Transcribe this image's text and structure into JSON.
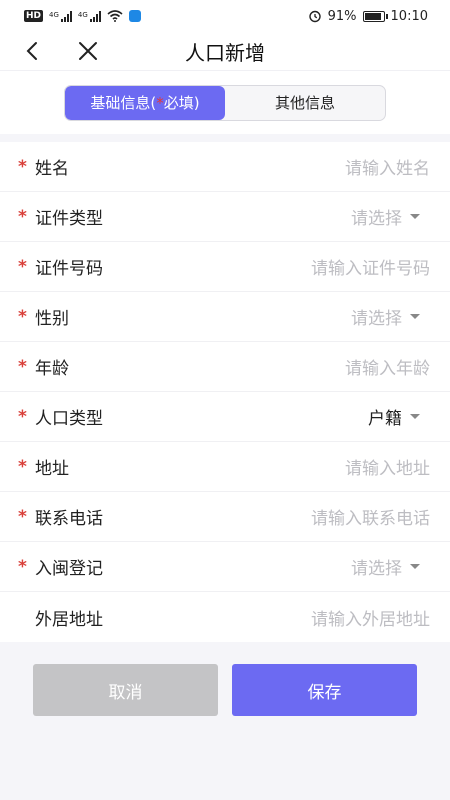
{
  "status_bar": {
    "hd": "HD",
    "sig1": "4G",
    "sig2": "4G",
    "battery_percent": "91%",
    "battery_level": 0.91,
    "time": "10:10"
  },
  "nav": {
    "title": "人口新增"
  },
  "tabs": {
    "basic_prefix": "基础信息(",
    "basic_star": "*",
    "basic_suffix": "必填)",
    "other": "其他信息"
  },
  "form": {
    "rows": [
      {
        "label": "姓名",
        "required": true,
        "value": "请输入姓名",
        "type": "input"
      },
      {
        "label": "证件类型",
        "required": true,
        "value": "请选择",
        "type": "select"
      },
      {
        "label": "证件号码",
        "required": true,
        "value": "请输入证件号码",
        "type": "input"
      },
      {
        "label": "性别",
        "required": true,
        "value": "请选择",
        "type": "select"
      },
      {
        "label": "年龄",
        "required": true,
        "value": "请输入年龄",
        "type": "input"
      },
      {
        "label": "人口类型",
        "required": true,
        "value": "户籍",
        "type": "select",
        "filled": true
      },
      {
        "label": "地址",
        "required": true,
        "value": "请输入地址",
        "type": "input"
      },
      {
        "label": "联系电话",
        "required": true,
        "value": "请输入联系电话",
        "type": "input"
      },
      {
        "label": "入闽登记",
        "required": true,
        "value": "请选择",
        "type": "select"
      },
      {
        "label": "外居地址",
        "required": false,
        "value": "请输入外居地址",
        "type": "input"
      }
    ]
  },
  "actions": {
    "cancel": "取消",
    "save": "保存"
  },
  "colors": {
    "accent": "#6c6af2",
    "required": "#d9413b",
    "placeholder": "#bdbdc2",
    "disabled": "#c4c4c6"
  },
  "required_mark": "*"
}
